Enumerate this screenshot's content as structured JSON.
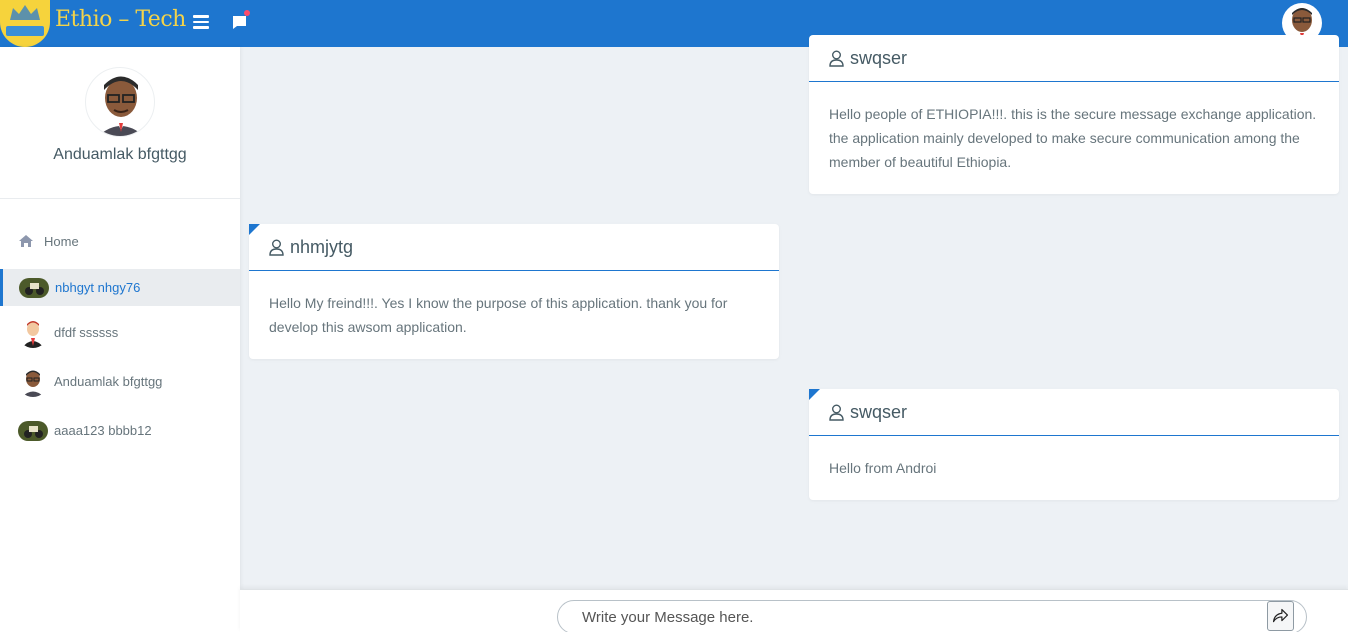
{
  "app": {
    "brand": "Ethio – Tech"
  },
  "colors": {
    "primary": "#1e76cf",
    "brand_text": "#f3d34a",
    "notify": "#fc4b6c"
  },
  "icons": {
    "menu": "hamburger-icon",
    "chat": "chat-bubble-icon",
    "home": "home-icon",
    "user": "user-outline-icon",
    "send": "share-arrow-icon"
  },
  "profile": {
    "name": "Anduamlak bfgttgg"
  },
  "sidebar": {
    "items": [
      {
        "label": "Home",
        "icon": "home-icon"
      },
      {
        "label": "nbhgyt nhgy76",
        "icon": "avatar-motorbike",
        "active": true
      },
      {
        "label": "dfdf ssssss",
        "icon": "avatar-man-suit"
      },
      {
        "label": "Anduamlak bfgttgg",
        "icon": "avatar-man-glasses"
      },
      {
        "label": "aaaa123 bbbb12",
        "icon": "avatar-motorbike"
      }
    ]
  },
  "messages": [
    {
      "sender": "swqser",
      "text": "Hello people of ETHIOPIA!!!. this is the secure message exchange application. the application mainly developed to make secure communication among the member of beautiful Ethiopia."
    },
    {
      "sender": "nhmjytg",
      "text": "Hello My freind!!!. Yes I know the purpose of this application. thank you for develop this awsom application."
    },
    {
      "sender": "swqser",
      "text": "Hello from Androi"
    }
  ],
  "composer": {
    "placeholder": "Write your Message here."
  }
}
